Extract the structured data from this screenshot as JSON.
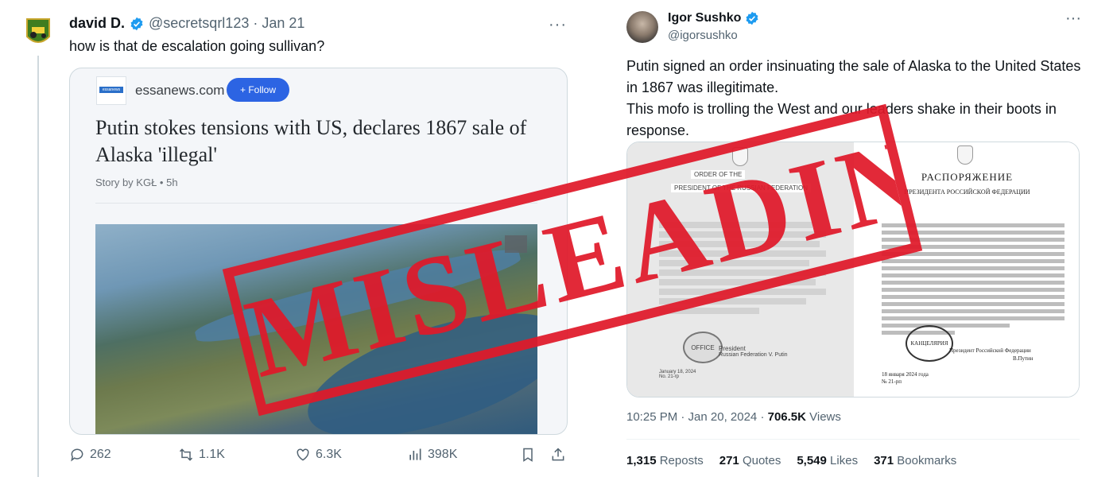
{
  "colors": {
    "accent": "#1d9bf0",
    "stamp": "#e0192a",
    "follow_bg": "#2c64e3",
    "muted": "#536471"
  },
  "left_tweet": {
    "author_name": "david D.",
    "handle_time": "@secretsqrl123 · Jan 21",
    "more": "···",
    "text": "how is that de escalation going sullivan?",
    "card": {
      "publisher_logo_text": "essanews",
      "publisher": "essanews.com",
      "follow_label": "+ Follow",
      "headline": "Putin stokes tensions with US, declares 1867 sale of Alaska 'illegal'",
      "byline": "Story by KGŁ • 5h"
    },
    "actions": {
      "replies": "262",
      "reposts": "1.1K",
      "likes": "6.3K",
      "views": "398K"
    }
  },
  "right_tweet": {
    "author_name": "Igor Sushko",
    "handle": "@igorsushko",
    "more": "···",
    "text_lines": [
      "Putin signed an order insinuating the sale of Alaska to the United States",
      "in 1867 was illegitimate.",
      "This mofo is trolling the West and our leaders shake in their boots in",
      "response."
    ],
    "document": {
      "en_title1": "ORDER OF THE",
      "en_title2": "PRESIDENT OF THE RUSSIAN FEDERATION",
      "en_stamp": "OFFICE",
      "en_president": "President",
      "en_president_sub": "Russian Federation V. Putin",
      "en_date": "January 18, 2024",
      "en_number": "No. 21-rp",
      "ru_title": "РАСПОРЯЖЕНИЕ",
      "ru_subtitle": "ПРЕЗИДЕНТА РОССИЙСКОЙ ФЕДЕРАЦИИ",
      "ru_stamp": "КАНЦЕЛЯРИЯ",
      "ru_president": "Президент Российской Федерации",
      "ru_sign": "В.Путин",
      "ru_date": "18 января 2024 года",
      "ru_number": "№ 21-рп"
    },
    "meta": {
      "time": "10:25 PM · Jan 20, 2024 · ",
      "views": "706.5K",
      "views_label": " Views"
    },
    "stats": {
      "reposts": "1,315",
      "reposts_label": "Reposts",
      "quotes": "271",
      "quotes_label": "Quotes",
      "likes": "5,549",
      "likes_label": "Likes",
      "bookmarks": "371",
      "bookmarks_label": "Bookmarks"
    }
  },
  "overlay": {
    "stamp_text": "MISLEADING"
  }
}
